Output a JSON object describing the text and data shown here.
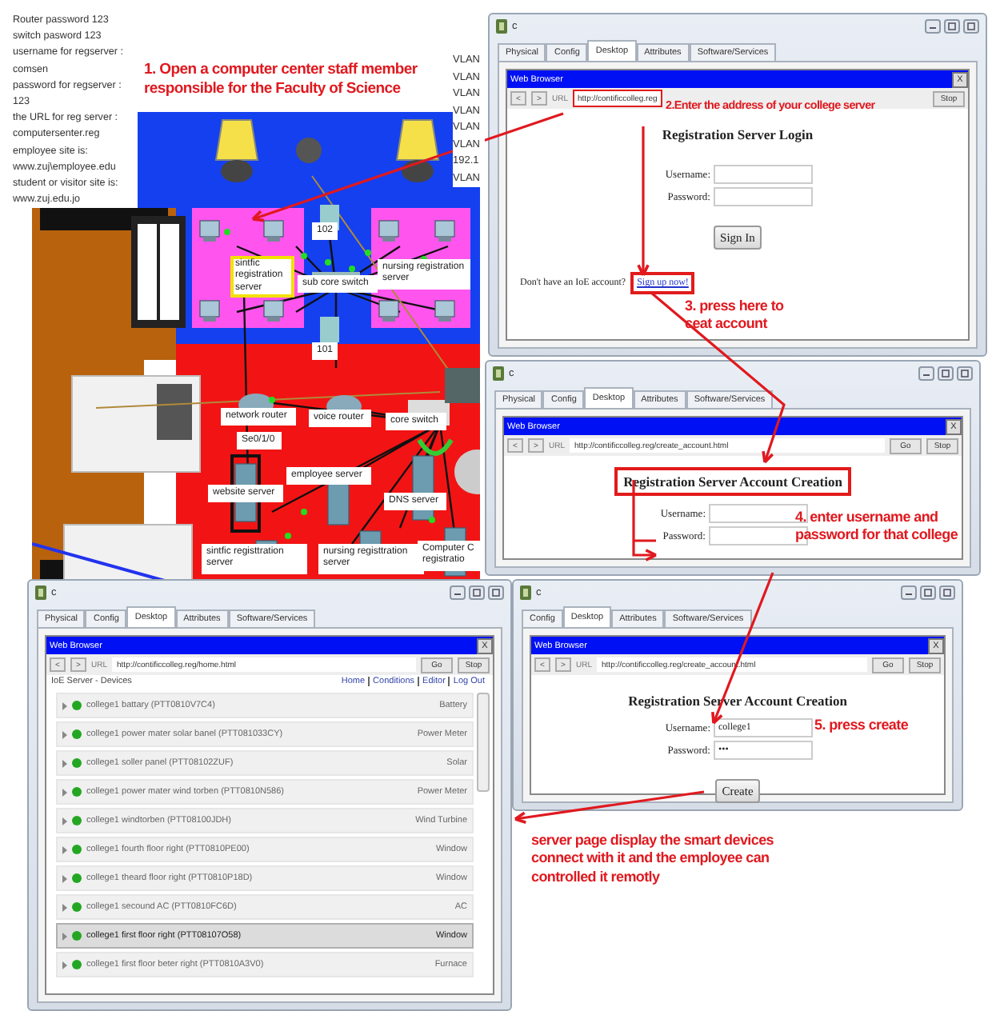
{
  "notes": [
    "Router password 123",
    "switch pasword 123",
    "username for regserver :",
    "comsen",
    "password for regserver :",
    "123",
    "the URL for reg server :",
    "computersenter.reg",
    "employee site is:",
    "www.zuj\\employee.edu",
    "student or visitor site is:",
    "www.zuj.edu.jo"
  ],
  "network": {
    "vlan_labels": [
      "VLAN",
      "VLAN",
      "VLAN",
      "VLAN",
      "VLAN",
      "VLAN",
      "192.1",
      "VLAN"
    ],
    "nodes": [
      {
        "label": "sintfic registration server",
        "highlighted": true
      },
      {
        "label": "sub core switch",
        "highlighted": false
      },
      {
        "label": "nursing registration server",
        "highlighted": false
      },
      {
        "label": "102",
        "highlighted": false
      },
      {
        "label": "101",
        "highlighted": false
      },
      {
        "label": "network router",
        "highlighted": false
      },
      {
        "label": "voice router",
        "highlighted": false
      },
      {
        "label": "core switch",
        "highlighted": false
      },
      {
        "label": "Se0/1/0",
        "highlighted": false
      },
      {
        "label": "website server",
        "highlighted": false
      },
      {
        "label": "employee server",
        "highlighted": false
      },
      {
        "label": "DNS server",
        "highlighted": false
      },
      {
        "label": "sintfic registtration server",
        "highlighted": false
      },
      {
        "label": "nursing registtration server",
        "highlighted": false
      },
      {
        "label": "Computer C registratio",
        "highlighted": false
      }
    ]
  },
  "windows": [
    {
      "title": "c",
      "tabs": [
        {
          "label": "Physical",
          "selected": false
        },
        {
          "label": "Config",
          "selected": false
        },
        {
          "label": "Desktop",
          "selected": true
        },
        {
          "label": "Attributes",
          "selected": false
        },
        {
          "label": "Software/Services",
          "selected": false
        }
      ],
      "browser": {
        "title": "Web Browser",
        "close": "X",
        "nav": [
          "<",
          ">"
        ],
        "url_label": "URL",
        "url": {
          "text": "http://contificcolleg.reg",
          "highlighted": true
        },
        "buttons": [
          "Stop"
        ]
      },
      "content": {
        "kind": "login",
        "heading": {
          "text": "Registration Server Login",
          "highlighted": false
        },
        "fields": [
          {
            "label": "Username:"
          },
          {
            "label": "Password:"
          }
        ],
        "button": "Sign In",
        "prompt": "Don't have an IoE account?",
        "link": {
          "text": "Sign up now!",
          "highlighted": true
        }
      }
    },
    {
      "title": "c",
      "tabs": [
        {
          "label": "Physical",
          "selected": false
        },
        {
          "label": "Config",
          "selected": false
        },
        {
          "label": "Desktop",
          "selected": true
        },
        {
          "label": "Attributes",
          "selected": false
        },
        {
          "label": "Software/Services",
          "selected": false
        }
      ],
      "browser": {
        "title": "Web Browser",
        "close": "X",
        "nav": [
          "<",
          ">"
        ],
        "url_label": "URL",
        "url": {
          "text": "http://contificcolleg.reg/create_account.html",
          "highlighted": false
        },
        "buttons": [
          "Go",
          "Stop"
        ]
      },
      "content": {
        "kind": "create",
        "heading": {
          "text": "Registration Server Account Creation",
          "highlighted": true
        },
        "fields": [
          {
            "label": "Username:"
          },
          {
            "label": "Password:"
          }
        ]
      }
    },
    {
      "title": "c",
      "tabs": [
        {
          "label": "Physical",
          "selected": false
        },
        {
          "label": "Config",
          "selected": false
        },
        {
          "label": "Desktop",
          "selected": true
        },
        {
          "label": "Attributes",
          "selected": false
        },
        {
          "label": "Software/Services",
          "selected": false
        }
      ],
      "browser": {
        "title": "Web Browser",
        "close": "X",
        "nav": [
          "<",
          ">"
        ],
        "url_label": "URL",
        "url": {
          "text": "http://contificcolleg.reg/home.html",
          "highlighted": false
        },
        "buttons": [
          "Go",
          "Stop"
        ]
      },
      "content": {
        "kind": "devices",
        "title": "IoE Server - Devices",
        "links": [
          "Home",
          "Conditions",
          "Editor",
          "Log Out"
        ],
        "rows": [
          {
            "name": "college1 battary (PTT0810V7C4)",
            "type": "Battery",
            "selected": false
          },
          {
            "name": "college1 power mater solar banel (PTT081033CY)",
            "type": "Power Meter",
            "selected": false
          },
          {
            "name": "college1 soller panel (PTT08102ZUF)",
            "type": "Solar",
            "selected": false
          },
          {
            "name": "college1 power mater wind torben (PTT0810N586)",
            "type": "Power Meter",
            "selected": false
          },
          {
            "name": "college1 windtorben (PTT08100JDH)",
            "type": "Wind Turbine",
            "selected": false
          },
          {
            "name": "college1 fourth floor right (PTT0810PE00)",
            "type": "Window",
            "selected": false
          },
          {
            "name": "college1 theard floor right (PTT0810P18D)",
            "type": "Window",
            "selected": false
          },
          {
            "name": "college1 secound AC (PTT0810FC6D)",
            "type": "AC",
            "selected": false
          },
          {
            "name": "college1 first floor right (PTT08107O58)",
            "type": "Window",
            "selected": true
          },
          {
            "name": "college1 first floor beter right (PTT0810A3V0)",
            "type": "Furnace",
            "selected": false
          }
        ]
      }
    },
    {
      "title": "c",
      "tabs": [
        {
          "label": "Config",
          "selected": false
        },
        {
          "label": "Desktop",
          "selected": true
        },
        {
          "label": "Attributes",
          "selected": false
        },
        {
          "label": "Software/Services",
          "selected": false
        }
      ],
      "browser": {
        "title": "Web Browser",
        "close": "X",
        "nav": [
          "<",
          ">"
        ],
        "url_label": "URL",
        "url": {
          "text": "http://contificcolleg.reg/create_account.html",
          "highlighted": false
        },
        "buttons": [
          "Go",
          "Stop"
        ]
      },
      "content": {
        "kind": "create",
        "heading": {
          "text": "Registration Server Account Creation",
          "highlighted": false
        },
        "fields": [
          {
            "label": "Username:",
            "value": "college1"
          },
          {
            "label": "Password:",
            "value": "•••"
          }
        ],
        "button": "Create"
      }
    }
  ],
  "annotations": [
    "1. Open a computer center staff member responsible for the Faculty of Science",
    "2.Enter the address of your college server",
    "3. press here to ceat account",
    "4. enter username and password for that college",
    "5. press create",
    "server page display the smart devices connect with it and the employee can controlled it remotly"
  ]
}
